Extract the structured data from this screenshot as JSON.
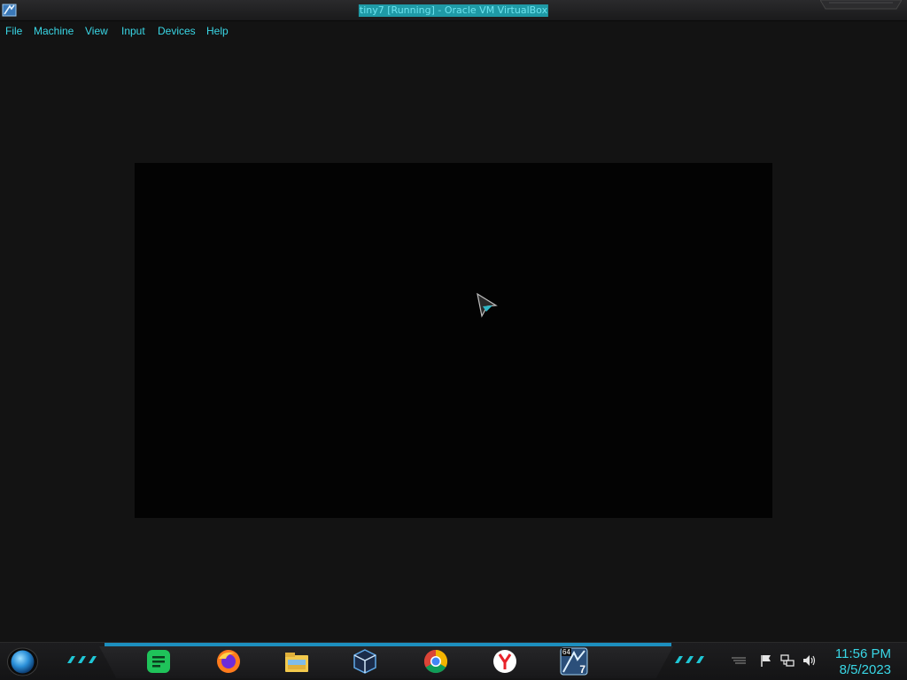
{
  "window": {
    "title": "tiny7 [Running] - Oracle VM VirtualBox"
  },
  "menu": {
    "items": [
      {
        "label": "File"
      },
      {
        "label": "Machine"
      },
      {
        "label": "View"
      },
      {
        "label": "Input"
      },
      {
        "label": "Devices"
      },
      {
        "label": "Help"
      }
    ]
  },
  "taskbar": {
    "apps": [
      {
        "name": "notes-app-icon",
        "color": "#1fc35a"
      },
      {
        "name": "firefox-icon",
        "color": "#ff7b1c"
      },
      {
        "name": "file-explorer-icon",
        "color": "#f2c94c"
      },
      {
        "name": "virtualbox-icon",
        "color": "#5fa8e8"
      },
      {
        "name": "chrome-icon",
        "color": "#db4437"
      },
      {
        "name": "yandex-browser-icon",
        "color": "#e8222a"
      },
      {
        "name": "virtualbox-vm-icon",
        "color": "#7ab8e6"
      }
    ],
    "vm_badge_top": "64",
    "vm_badge_bottom": "7",
    "clock": {
      "time": "11:56 PM",
      "date": "8/5/2023"
    }
  },
  "colors": {
    "accent": "#39d7e6",
    "title_highlight": "#1f9aa6",
    "background": "#131313"
  }
}
